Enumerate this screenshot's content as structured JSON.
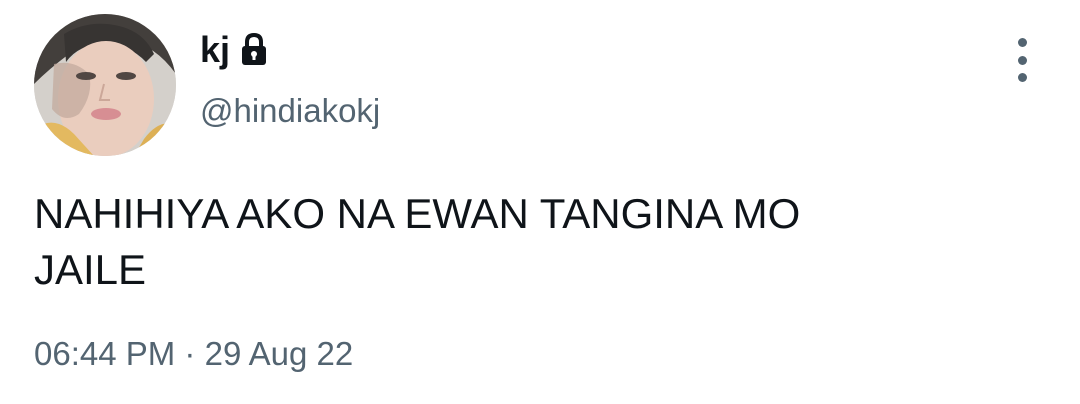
{
  "author": {
    "display_name": "kj",
    "handle": "@hindiakokj",
    "protected_icon": "lock-icon",
    "avatar": "avatar-photo"
  },
  "tweet": {
    "text": "NAHIHIYA AKO NA EWAN TANGINA MO\nJAILE",
    "time": "06:44 PM",
    "separator": "·",
    "date": "29 Aug 22"
  },
  "actions": {
    "more_icon": "more-vertical-icon"
  },
  "colors": {
    "primary_text": "#0f1419",
    "secondary_text": "#536471",
    "background": "#ffffff"
  }
}
